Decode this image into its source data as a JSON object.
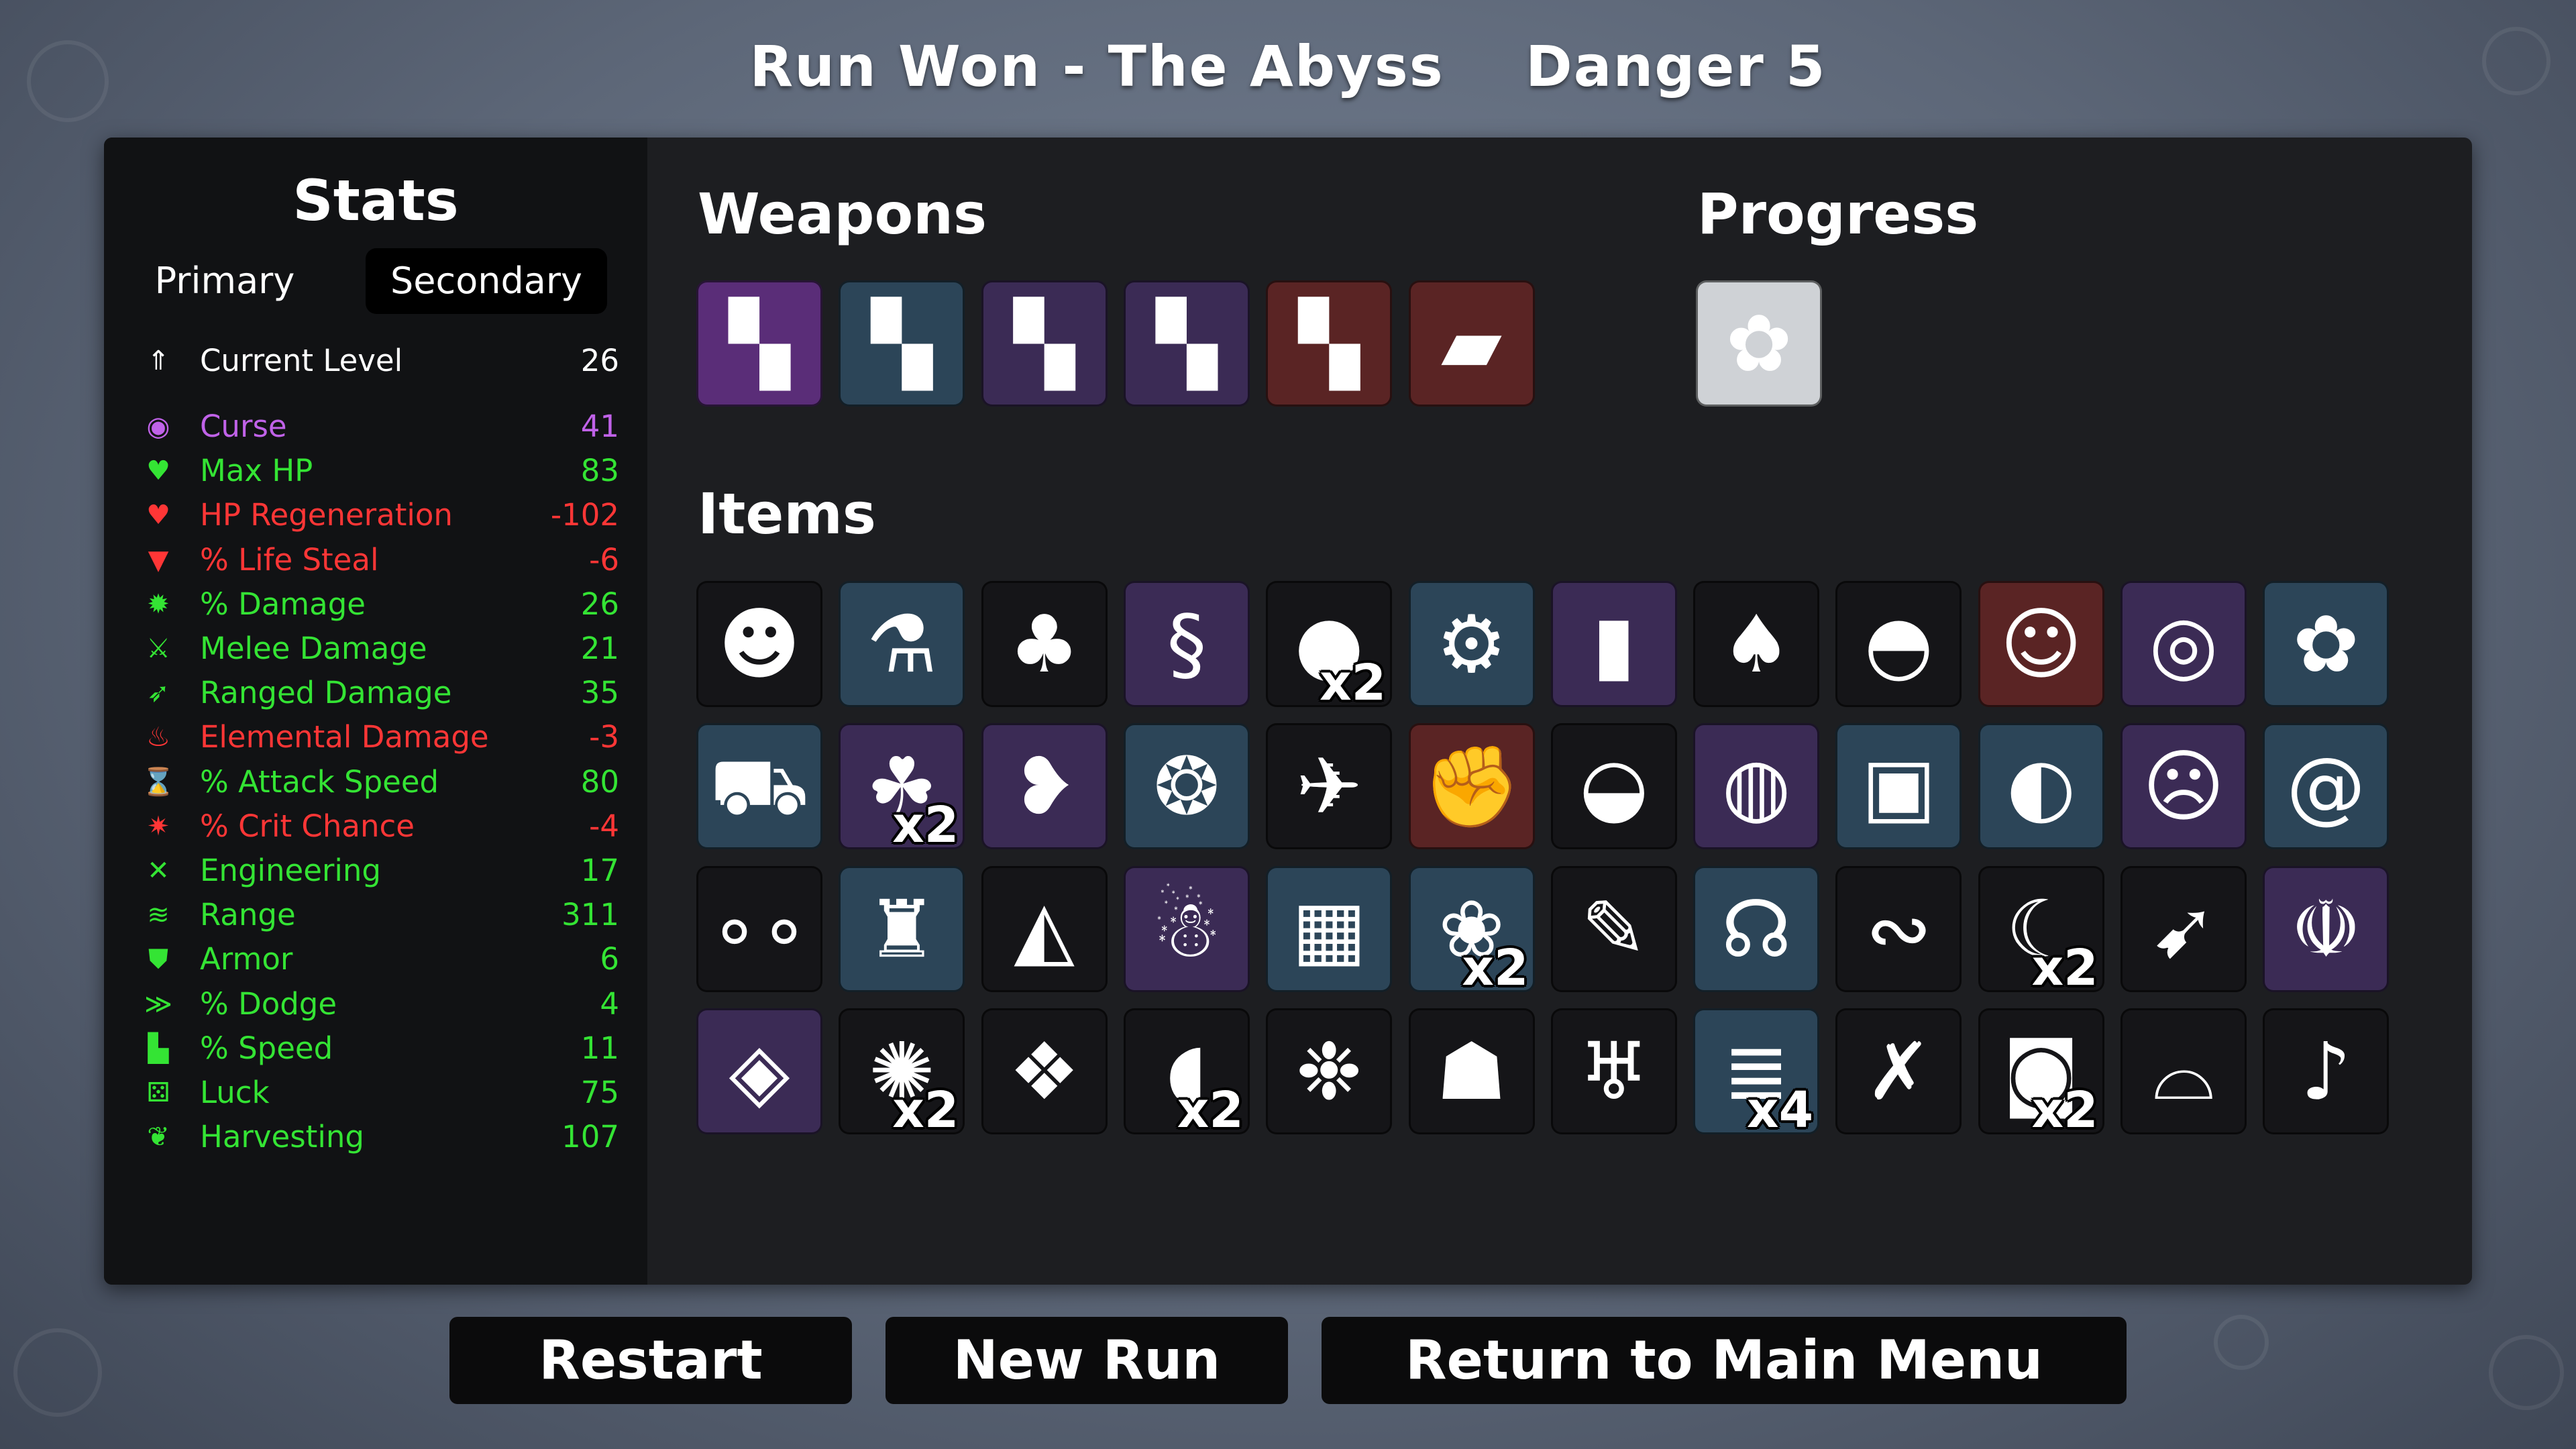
{
  "header": {
    "run_result": "Run Won - The Abyss",
    "danger": "Danger 5"
  },
  "stats": {
    "title": "Stats",
    "tabs": [
      {
        "label": "Primary",
        "active": false
      },
      {
        "label": "Secondary",
        "active": true
      }
    ],
    "rows": [
      {
        "label": "Current Level",
        "value": "26",
        "color": "#ffffff",
        "icon": "level-up-icon",
        "glyph": "⇑"
      },
      {
        "label": "Curse",
        "value": "41",
        "color": "#c062e8",
        "icon": "curse-eye-icon",
        "glyph": "◉"
      },
      {
        "label": "Max HP",
        "value": "83",
        "color": "#34e434",
        "icon": "heart-icon",
        "glyph": "♥"
      },
      {
        "label": "HP Regeneration",
        "value": "-102",
        "color": "#ff3636",
        "icon": "regen-heart-icon",
        "glyph": "♥"
      },
      {
        "label": "% Life Steal",
        "value": "-6",
        "color": "#ff3636",
        "icon": "life-steal-fang-icon",
        "glyph": "▼"
      },
      {
        "label": "% Damage",
        "value": "26",
        "color": "#34e434",
        "icon": "brain-damage-icon",
        "glyph": "✹"
      },
      {
        "label": "Melee Damage",
        "value": "21",
        "color": "#34e434",
        "icon": "sword-icon",
        "glyph": "⚔"
      },
      {
        "label": "Ranged Damage",
        "value": "35",
        "color": "#34e434",
        "icon": "bow-icon",
        "glyph": "➶"
      },
      {
        "label": "Elemental Damage",
        "value": "-3",
        "color": "#ff3636",
        "icon": "flame-icon",
        "glyph": "♨"
      },
      {
        "label": "% Attack Speed",
        "value": "80",
        "color": "#34e434",
        "icon": "hourglass-icon",
        "glyph": "⌛"
      },
      {
        "label": "% Crit Chance",
        "value": "-4",
        "color": "#ff3636",
        "icon": "crit-burst-icon",
        "glyph": "✷"
      },
      {
        "label": "Engineering",
        "value": "17",
        "color": "#34e434",
        "icon": "wrench-icon",
        "glyph": "✕"
      },
      {
        "label": "Range",
        "value": "311",
        "color": "#34e434",
        "icon": "range-signal-icon",
        "glyph": "≋"
      },
      {
        "label": "Armor",
        "value": "6",
        "color": "#34e434",
        "icon": "shield-icon",
        "glyph": "⛊"
      },
      {
        "label": "% Dodge",
        "value": "4",
        "color": "#34e434",
        "icon": "dodge-wind-icon",
        "glyph": "≫"
      },
      {
        "label": "% Speed",
        "value": "11",
        "color": "#34e434",
        "icon": "boot-icon",
        "glyph": "▙"
      },
      {
        "label": "Luck",
        "value": "75",
        "color": "#34e434",
        "icon": "dice-icon",
        "glyph": "⚄"
      },
      {
        "label": "Harvesting",
        "value": "107",
        "color": "#34e434",
        "icon": "wheat-icon",
        "glyph": "❦"
      }
    ]
  },
  "weapons": {
    "title": "Weapons",
    "slots": [
      {
        "icon": "minigun-weapon-icon",
        "glyph": "▚",
        "tier_color": "#5a2d78"
      },
      {
        "icon": "minigun-weapon-icon",
        "glyph": "▚",
        "tier_color": "#2c4558"
      },
      {
        "icon": "minigun-weapon-icon",
        "glyph": "▚",
        "tier_color": "#3b2b55"
      },
      {
        "icon": "minigun-weapon-icon",
        "glyph": "▚",
        "tier_color": "#3b2b55"
      },
      {
        "icon": "minigun-weapon-icon",
        "glyph": "▚",
        "tier_color": "#5a2424"
      },
      {
        "icon": "rocket-launcher-weapon-icon",
        "glyph": "▰",
        "tier_color": "#5a2424"
      }
    ]
  },
  "progress": {
    "title": "Progress",
    "slots": [
      {
        "icon": "brain-progress-icon",
        "glyph": "✿",
        "tier_color": "#cfd2d6"
      }
    ]
  },
  "items": {
    "title": "Items",
    "slots": [
      {
        "icon": "ghost-mask-item-icon",
        "glyph": "☻",
        "tier_color": "#151518",
        "count": ""
      },
      {
        "icon": "green-potion-item-icon",
        "glyph": "⚗",
        "tier_color": "#2c4558",
        "count": ""
      },
      {
        "icon": "tree-item-icon",
        "glyph": "♣",
        "tier_color": "#151518",
        "count": ""
      },
      {
        "icon": "tentacle-item-icon",
        "glyph": "§",
        "tier_color": "#3b2b55",
        "count": ""
      },
      {
        "icon": "boxing-glove-item-icon",
        "glyph": "●",
        "tier_color": "#151518",
        "count": "x2"
      },
      {
        "icon": "mechanical-arm-item-icon",
        "glyph": "⚙",
        "tier_color": "#2c4558",
        "count": ""
      },
      {
        "icon": "bullet-item-icon",
        "glyph": "▮",
        "tier_color": "#3b2b55",
        "count": ""
      },
      {
        "icon": "fertilizer-bag-item-icon",
        "glyph": "♠",
        "tier_color": "#151518",
        "count": ""
      },
      {
        "icon": "beanie-hat-item-icon",
        "glyph": "◓",
        "tier_color": "#151518",
        "count": ""
      },
      {
        "icon": "bald-man-item-icon",
        "glyph": "☺",
        "tier_color": "#5a2424",
        "count": ""
      },
      {
        "icon": "cyber-barrel-item-icon",
        "glyph": "◎",
        "tier_color": "#3b2b55",
        "count": ""
      },
      {
        "icon": "frog-item-icon",
        "glyph": "✿",
        "tier_color": "#2c4558",
        "count": ""
      },
      {
        "icon": "wheelbarrow-item-icon",
        "glyph": "⛟",
        "tier_color": "#2c4558",
        "count": ""
      },
      {
        "icon": "clover-item-icon",
        "glyph": "☘",
        "tier_color": "#3b2b55",
        "count": "x2"
      },
      {
        "icon": "goldfish-item-icon",
        "glyph": "❥",
        "tier_color": "#3b2b55",
        "count": ""
      },
      {
        "icon": "angel-orb-item-icon",
        "glyph": "❂",
        "tier_color": "#2c4558",
        "count": ""
      },
      {
        "icon": "alien-ship-item-icon",
        "glyph": "✈",
        "tier_color": "#151518",
        "count": ""
      },
      {
        "icon": "flexed-arm-item-icon",
        "glyph": "✊",
        "tier_color": "#5a2424",
        "count": ""
      },
      {
        "icon": "helmet-item-icon",
        "glyph": "◒",
        "tier_color": "#151518",
        "count": ""
      },
      {
        "icon": "bug-jar-item-icon",
        "glyph": "◍",
        "tier_color": "#3b2b55",
        "count": ""
      },
      {
        "icon": "water-jar-item-icon",
        "glyph": "▣",
        "tier_color": "#2c4558",
        "count": ""
      },
      {
        "icon": "flashlight-item-icon",
        "glyph": "◐",
        "tier_color": "#2c4558",
        "count": ""
      },
      {
        "icon": "mummy-head-item-icon",
        "glyph": "☹",
        "tier_color": "#3b2b55",
        "count": ""
      },
      {
        "icon": "snail-item-icon",
        "glyph": "@",
        "tier_color": "#2c4558",
        "count": ""
      },
      {
        "icon": "glowing-eyes-item-icon",
        "glyph": "∘∘",
        "tier_color": "#151518",
        "count": ""
      },
      {
        "icon": "ketchup-bottle-item-icon",
        "glyph": "♜",
        "tier_color": "#2c4558",
        "count": ""
      },
      {
        "icon": "cake-slice-item-icon",
        "glyph": "◭",
        "tier_color": "#151518",
        "count": ""
      },
      {
        "icon": "mustache-mask-item-icon",
        "glyph": "☃",
        "tier_color": "#3b2b55",
        "count": ""
      },
      {
        "icon": "scrap-metal-item-icon",
        "glyph": "▦",
        "tier_color": "#2c4558",
        "count": ""
      },
      {
        "icon": "white-rabbit-item-icon",
        "glyph": "❀",
        "tier_color": "#2c4558",
        "count": "x2"
      },
      {
        "icon": "syringe-item-icon",
        "glyph": "✎",
        "tier_color": "#151518",
        "count": ""
      },
      {
        "icon": "amulet-necklace-item-icon",
        "glyph": "☊",
        "tier_color": "#2c4558",
        "count": ""
      },
      {
        "icon": "lizard-item-icon",
        "glyph": "∾",
        "tier_color": "#151518",
        "count": ""
      },
      {
        "icon": "scythe-pot-item-icon",
        "glyph": "☾",
        "tier_color": "#151518",
        "count": "x2"
      },
      {
        "icon": "rocket-item-icon",
        "glyph": "➹",
        "tier_color": "#151518",
        "count": ""
      },
      {
        "icon": "angel-wings-item-icon",
        "glyph": "☫",
        "tier_color": "#3b2b55",
        "count": ""
      },
      {
        "icon": "eye-ring-item-icon",
        "glyph": "◈",
        "tier_color": "#3b2b55",
        "count": ""
      },
      {
        "icon": "hedgehog-item-icon",
        "glyph": "✺",
        "tier_color": "#151518",
        "count": "x2"
      },
      {
        "icon": "lucky-cat-item-icon",
        "glyph": "❖",
        "tier_color": "#151518",
        "count": ""
      },
      {
        "icon": "shark-tooth-item-icon",
        "glyph": "◖",
        "tier_color": "#151518",
        "count": "x2"
      },
      {
        "icon": "pufferfish-item-icon",
        "glyph": "❉",
        "tier_color": "#151518",
        "count": ""
      },
      {
        "icon": "hooded-ghost-item-icon",
        "glyph": "☗",
        "tier_color": "#151518",
        "count": ""
      },
      {
        "icon": "tooth-item-icon",
        "glyph": "♅",
        "tier_color": "#151518",
        "count": ""
      },
      {
        "icon": "metal-coil-item-icon",
        "glyph": "≣",
        "tier_color": "#2c4558",
        "count": "x4"
      },
      {
        "icon": "thorn-branch-item-icon",
        "glyph": "✗",
        "tier_color": "#151518",
        "count": ""
      },
      {
        "icon": "toilet-paper-item-icon",
        "glyph": "◙",
        "tier_color": "#151518",
        "count": "x2"
      },
      {
        "icon": "propeller-hat-item-icon",
        "glyph": "⌓",
        "tier_color": "#151518",
        "count": ""
      },
      {
        "icon": "whistle-item-icon",
        "glyph": "♪",
        "tier_color": "#151518",
        "count": ""
      }
    ]
  },
  "buttons": {
    "restart": "Restart",
    "new_run": "New Run",
    "main_menu": "Return to Main Menu"
  }
}
